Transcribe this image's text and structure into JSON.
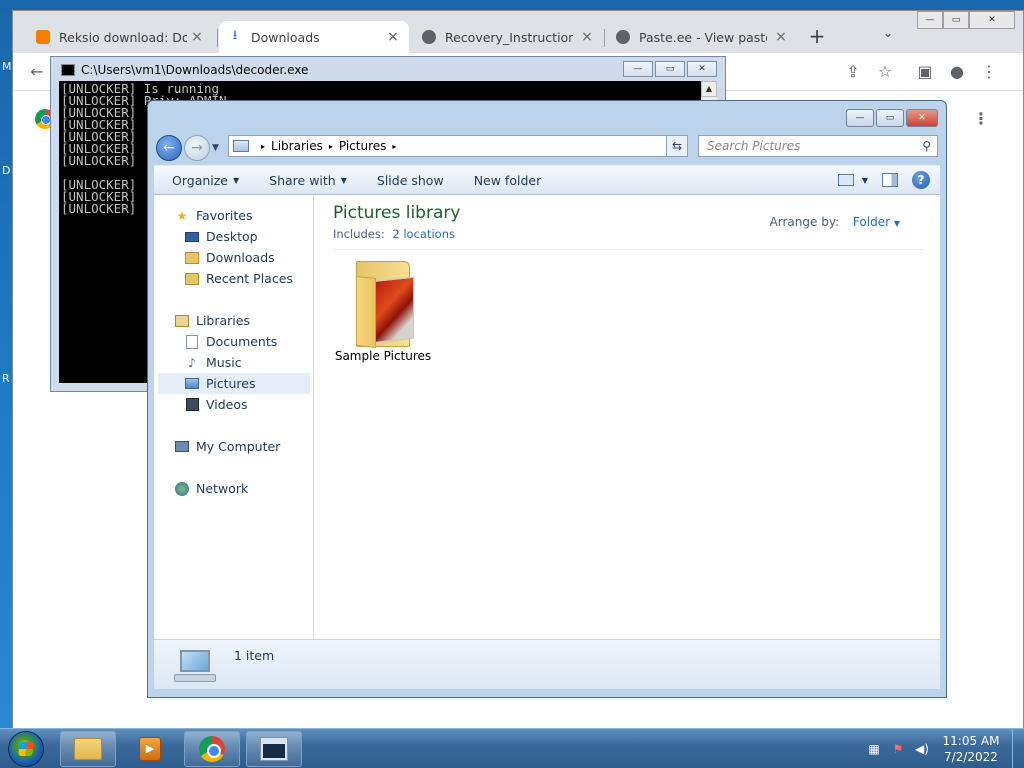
{
  "desktop": {
    "edge_letters": [
      "M",
      "D",
      "R"
    ]
  },
  "chrome": {
    "tabs": [
      {
        "title": "Reksio download: Down",
        "icon": "blogger-icon",
        "active": false
      },
      {
        "title": "Downloads",
        "icon": "download-icon",
        "active": true
      },
      {
        "title": "Recovery_Instructions.ht",
        "icon": "globe-icon",
        "active": false
      },
      {
        "title": "Paste.ee - View paste ab",
        "icon": "globe-icon",
        "active": false
      }
    ],
    "new_tab_label": "+",
    "tab_close_label": "×",
    "toolbar": {
      "back_glyph": "←",
      "share_glyph": "⇪",
      "star_glyph": "☆",
      "sidepanel_glyph": "▣",
      "profile_glyph": "●",
      "menu_glyph": "⋮"
    },
    "window_controls": {
      "minimize": "—",
      "maximize": "▭",
      "close": "✕"
    }
  },
  "console": {
    "title": "C:\\Users\\vm1\\Downloads\\decoder.exe",
    "lines": [
      "[UNLOCKER] Is running",
      "[UNLOCKER] Priv: ADMIN",
      "[UNLOCKER]",
      "[UNLOCKER]",
      "[UNLOCKER]",
      "[UNLOCKER]",
      "[UNLOCKER]",
      "",
      "[UNLOCKER]",
      "[UNLOCKER]",
      "[UNLOCKER]"
    ],
    "controls": {
      "minimize": "—",
      "maximize": "▭",
      "close": "✕"
    },
    "scroll_up_glyph": "▲"
  },
  "explorer": {
    "controls": {
      "minimize": "—",
      "maximize": "▭",
      "close": "✕"
    },
    "address": {
      "crumbs": [
        "Libraries",
        "Pictures"
      ],
      "separator": "▸"
    },
    "search_placeholder": "Search Pictures",
    "commands": [
      "Organize",
      "Share with",
      "Slide show",
      "New folder"
    ],
    "nav": {
      "favorites_header": "Favorites",
      "favorites": [
        "Desktop",
        "Downloads",
        "Recent Places"
      ],
      "libraries_header": "Libraries",
      "libraries": [
        "Documents",
        "Music",
        "Pictures",
        "Videos"
      ],
      "selected": "Pictures",
      "computer": "My Computer",
      "network": "Network"
    },
    "library": {
      "title": "Pictures library",
      "includes_label": "Includes:",
      "includes_link": "2 locations",
      "arrange_label": "Arrange by:",
      "arrange_value": "Folder"
    },
    "items": [
      {
        "name": "Sample Pictures",
        "type": "folder"
      }
    ],
    "status": "1 item"
  },
  "taskbar": {
    "clock_time": "11:05 AM",
    "clock_date": "7/2/2022",
    "tray_icons": [
      "network-icon",
      "flag-alert-icon",
      "volume-icon"
    ]
  }
}
